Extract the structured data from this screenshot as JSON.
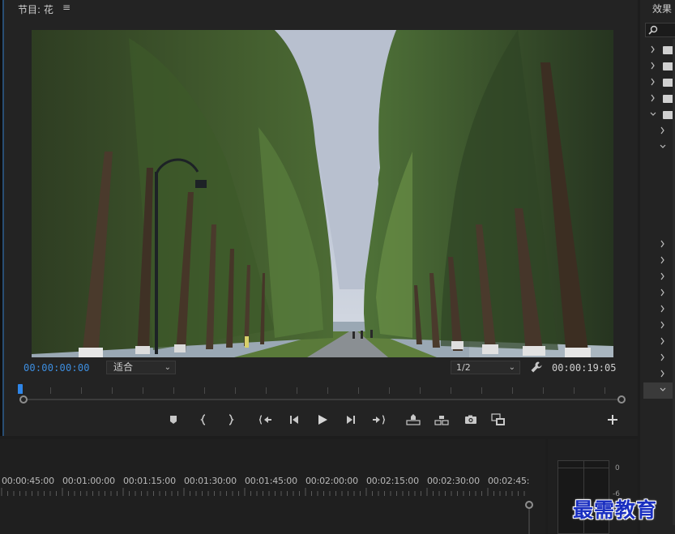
{
  "program_monitor": {
    "title": "节目: 花",
    "menu_icon": "hamburger-menu-icon",
    "current_timecode": "00:00:00:00",
    "zoom_value": "适合",
    "resolution_value": "1/2",
    "duration_timecode": "00:00:19:05",
    "accent_color": "#3d8ee0"
  },
  "transport": {
    "buttons": [
      {
        "name": "add-marker-icon"
      },
      {
        "name": "mark-in-icon"
      },
      {
        "name": "mark-out-icon"
      },
      {
        "name": "go-to-in-icon"
      },
      {
        "name": "step-back-icon"
      },
      {
        "name": "play-icon"
      },
      {
        "name": "step-forward-icon"
      },
      {
        "name": "go-to-out-icon"
      },
      {
        "name": "lift-icon"
      },
      {
        "name": "extract-icon"
      },
      {
        "name": "export-frame-icon"
      },
      {
        "name": "comparison-view-icon"
      },
      {
        "name": "button-editor-plus-icon"
      }
    ]
  },
  "timeline": {
    "ruler_labels": [
      "00:00:45:00",
      "00:01:00:00",
      "00:01:15:00",
      "00:01:30:00",
      "00:01:45:00",
      "00:02:00:00",
      "00:02:15:00",
      "00:02:30:00",
      "00:02:45:"
    ]
  },
  "audio_meter": {
    "db_labels": [
      "0",
      "-6"
    ]
  },
  "effects_panel": {
    "tab_label": "效果"
  },
  "watermark": {
    "text": "最需教育"
  }
}
